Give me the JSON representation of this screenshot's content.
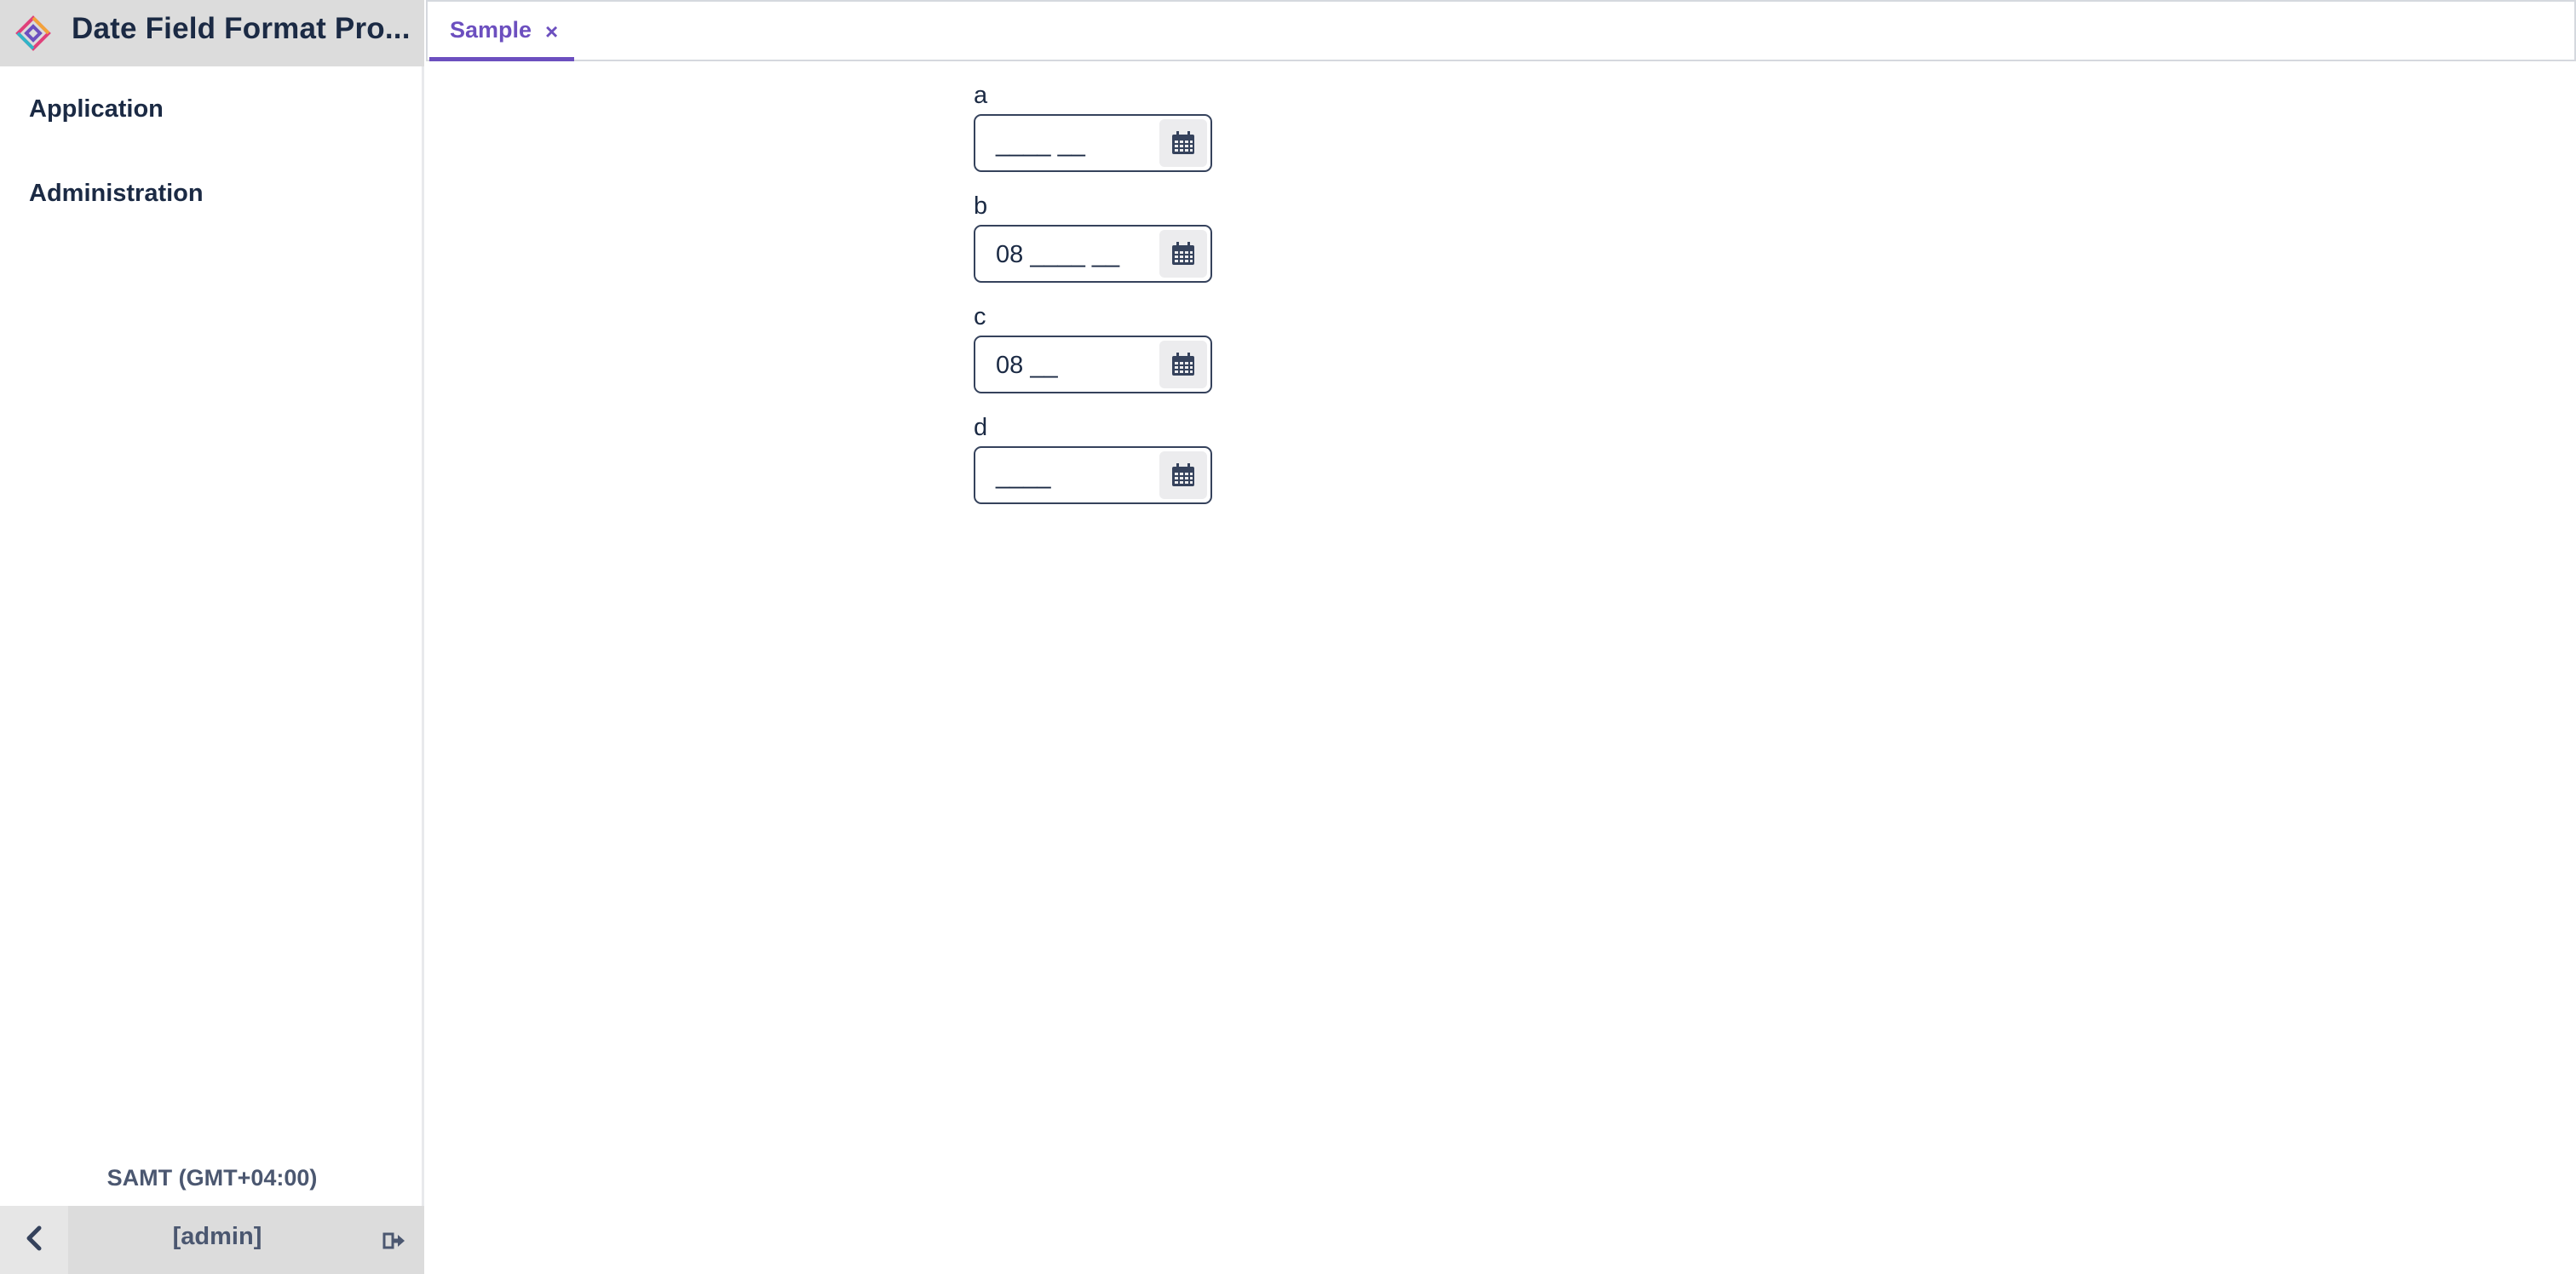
{
  "app": {
    "title": "Date Field Format Pro...",
    "logo_icon": "app-logo-icon"
  },
  "sidebar": {
    "menu": [
      {
        "label": "Application"
      },
      {
        "label": "Administration"
      }
    ],
    "timezone": "SAMT (GMT+04:00)",
    "user": "[admin]",
    "collapse_icon": "chevron-left-icon",
    "logout_icon": "logout-icon"
  },
  "tabs": [
    {
      "label": "Sample",
      "close": "×"
    }
  ],
  "form": {
    "fields": [
      {
        "label": "a",
        "value": "____ __"
      },
      {
        "label": "b",
        "value": "08 ____ __"
      },
      {
        "label": "c",
        "value": "08 __"
      },
      {
        "label": "d",
        "value": "____"
      }
    ],
    "picker_icon": "calendar-icon"
  },
  "colors": {
    "accent": "#6c4fbf",
    "text": "#1b2a44",
    "header_bg": "#dcdcdc"
  }
}
